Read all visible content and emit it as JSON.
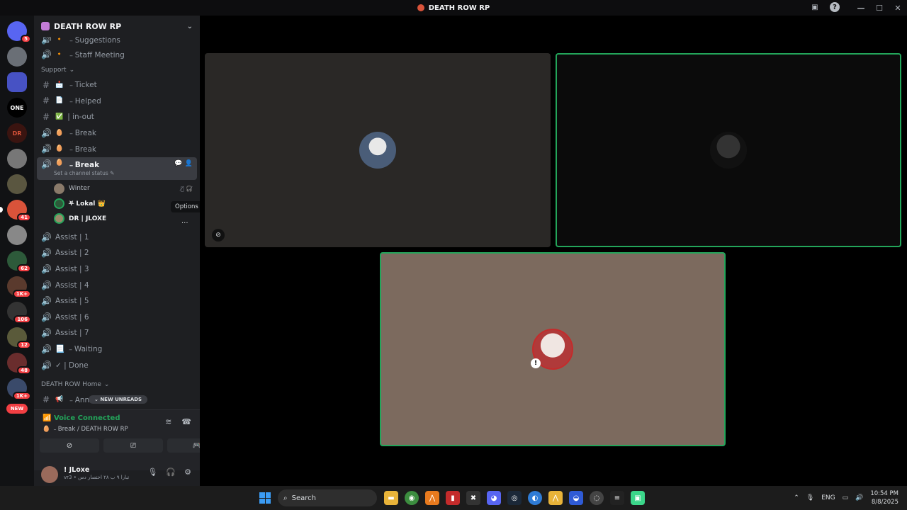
{
  "window": {
    "title": "DEATH ROW RP"
  },
  "guilds": {
    "items": [
      {
        "label": "",
        "badge": "5"
      },
      {
        "label": "",
        "badge": ""
      },
      {
        "label": "",
        "badge": ""
      },
      {
        "label": "ONE",
        "badge": ""
      },
      {
        "label": "DR",
        "badge": ""
      },
      {
        "label": "",
        "badge": ""
      },
      {
        "label": "",
        "badge": ""
      },
      {
        "label": "",
        "badge": "41"
      },
      {
        "label": "",
        "badge": ""
      },
      {
        "label": "",
        "badge": "62"
      },
      {
        "label": "",
        "badge": "1K+"
      },
      {
        "label": "",
        "badge": "106"
      },
      {
        "label": "",
        "badge": "12"
      },
      {
        "label": "",
        "badge": "48"
      },
      {
        "label": "",
        "badge": "1K+"
      }
    ],
    "new_label": "NEW"
  },
  "server": {
    "name": "DEATH ROW RP"
  },
  "channels": {
    "top": [
      {
        "icon": "voice",
        "emoji": "🔸",
        "name": "﹣Suggestions"
      },
      {
        "icon": "voice",
        "emoji": "🔸",
        "name": "﹣Staff Meeting"
      }
    ],
    "support_category": "Support",
    "support": [
      {
        "icon": "#",
        "emoji": "📩",
        "name": "﹣Ticket"
      },
      {
        "icon": "#",
        "emoji": "📄",
        "name": "﹣Helped"
      },
      {
        "icon": "#",
        "emoji": "✅",
        "name": "| in-out"
      },
      {
        "icon": "voice",
        "emoji": "🥚",
        "name": "﹣Break"
      },
      {
        "icon": "voice",
        "emoji": "🥚",
        "name": "﹣Break"
      }
    ],
    "active": {
      "emoji": "🥚",
      "name": "﹣Break",
      "sub": "Set a channel status ✎"
    },
    "members": [
      {
        "name": "Winter",
        "bold": false
      },
      {
        "name": "⛧ Lokal 👑",
        "bold": true
      },
      {
        "name": "DR | JLOXE",
        "bold": true
      }
    ],
    "assists": [
      {
        "icon": "voice",
        "name": "Assist | 1"
      },
      {
        "icon": "voice",
        "name": "Assist | 2"
      },
      {
        "icon": "voice",
        "name": "Assist | 3"
      },
      {
        "icon": "voice",
        "name": "Assist | 4"
      },
      {
        "icon": "voice",
        "name": "Assist | 5"
      },
      {
        "icon": "voice",
        "name": "Assist | 6"
      },
      {
        "icon": "voice",
        "name": "Assist | 7"
      },
      {
        "icon": "voice",
        "name": "📃 ﹣Waiting"
      },
      {
        "icon": "voice",
        "name": "✓ | Done"
      }
    ],
    "home_category": "DEATH ROW Home",
    "announcements": "﹣Announcements"
  },
  "tooltip": "Options",
  "new_unreads": "NEW UNREADS",
  "voice": {
    "status": "Voice Connected",
    "channel": "🥚 ﹣Break / DEATH ROW RP"
  },
  "user": {
    "name": "! JLoxe",
    "status": "vr3 • تبارا ٩ ب ٢٨ اختصار دس"
  },
  "taskbar": {
    "search_label": "Search",
    "lang": "ENG",
    "time": "10:54 PM",
    "date": "8/8/2025"
  },
  "colors": {
    "accent_green": "#23a55a",
    "badge_red": "#f23f43",
    "sidebar_bg": "#1e1f22"
  }
}
